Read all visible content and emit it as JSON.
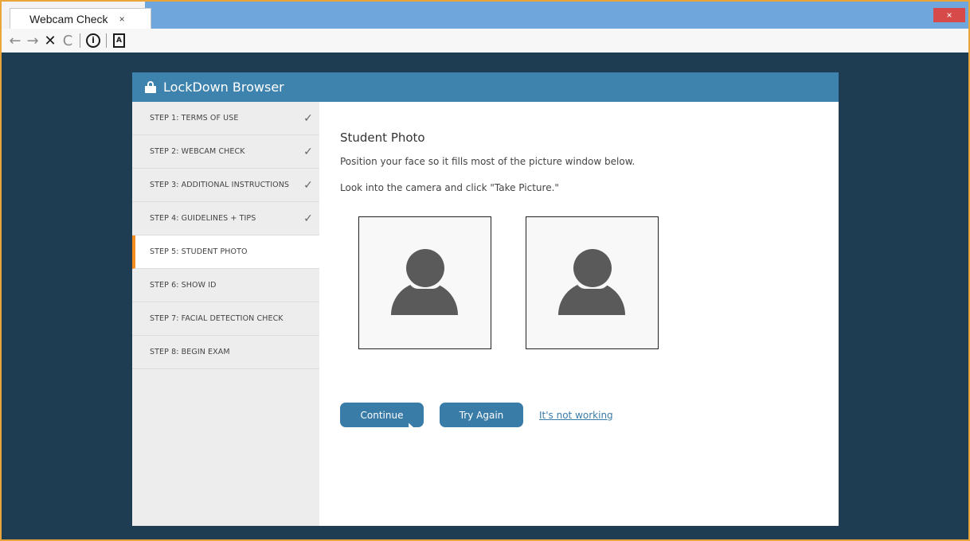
{
  "browser": {
    "tab_title": "Webcam Check",
    "tab_close": "×",
    "window_close": "×",
    "nav": {
      "back": "←",
      "forward": "→",
      "stop": "✕",
      "reload": "C",
      "info": "i",
      "doc": "A"
    }
  },
  "app": {
    "title": "LockDown Browser",
    "steps": [
      {
        "label": "STEP 1: TERMS OF USE",
        "done": "✓"
      },
      {
        "label": "STEP 2: WEBCAM CHECK",
        "done": "✓"
      },
      {
        "label": "STEP 3: ADDITIONAL INSTRUCTIONS",
        "done": "✓"
      },
      {
        "label": "STEP 4: GUIDELINES + TIPS",
        "done": "✓"
      },
      {
        "label": "STEP 5: STUDENT PHOTO",
        "done": ""
      },
      {
        "label": "STEP 6: SHOW ID",
        "done": ""
      },
      {
        "label": "STEP 7: FACIAL DETECTION CHECK",
        "done": ""
      },
      {
        "label": "STEP 8: BEGIN EXAM",
        "done": ""
      }
    ],
    "active_step": 5,
    "main": {
      "heading": "Student Photo",
      "instruction_1": "Position your face so it fills most of the picture window below.",
      "instruction_2": "Look into the camera and click \"Take Picture.\"",
      "continue_label": "Continue",
      "try_again_label": "Try Again",
      "not_working_label": "It's not working"
    }
  },
  "colors": {
    "header_blue": "#3e83ae",
    "active_accent": "#f28a1d",
    "button_blue": "#3a7ca8",
    "page_background": "#1f3d52"
  }
}
